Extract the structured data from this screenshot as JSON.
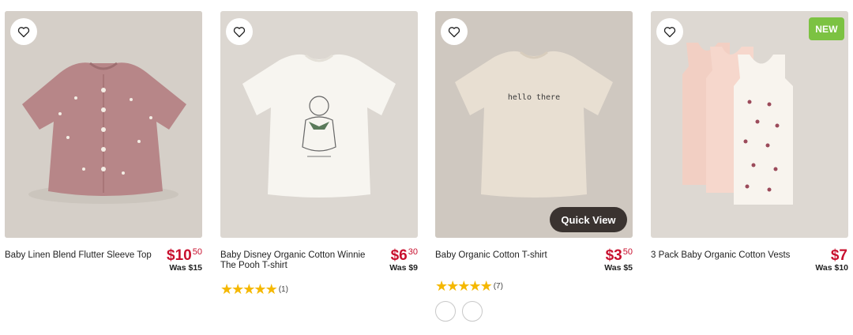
{
  "products": [
    {
      "name": "Baby Linen Blend Flutter Sleeve Top",
      "price_dollars": "$10",
      "price_cents": "50",
      "was": "Was $15",
      "image": "pink-flutter-sleeve-top"
    },
    {
      "name": "Baby Disney Organic Cotton Winnie The Pooh T-shirt",
      "price_dollars": "$6",
      "price_cents": "30",
      "was": "Was $9",
      "rating": 5,
      "review_count": "(1)",
      "image": "white-pooh-tshirt"
    },
    {
      "name": "Baby Organic Cotton T-shirt",
      "price_dollars": "$3",
      "price_cents": "50",
      "was": "Was $5",
      "rating": 4.5,
      "review_count": "(7)",
      "image": "beige-hello-there-tshirt",
      "shirt_print": "hello there",
      "quick_view": "Quick View"
    },
    {
      "name": "3 Pack Baby Organic Cotton Vests",
      "price_dollars": "$7",
      "price_cents": "",
      "was": "Was $10",
      "badge": "NEW",
      "image": "pink-vest-3-pack"
    }
  ],
  "colors": {
    "sale_red": "#c8102e",
    "star_yellow": "#f5b800",
    "badge_green": "#7cc242",
    "quick_view_bg": "#3a3330"
  },
  "icons": [
    "heart-icon",
    "star-icon"
  ]
}
